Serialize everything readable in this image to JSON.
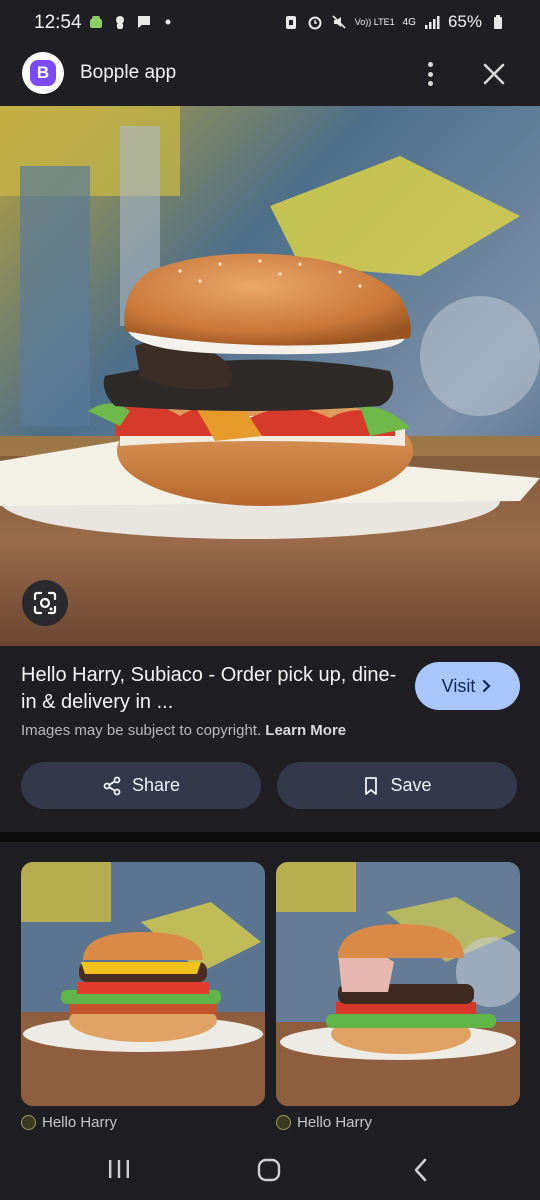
{
  "status": {
    "time": "12:54",
    "volte": "Vo)) LTE1",
    "network": "4G",
    "battery": "65%"
  },
  "app": {
    "title": "Bopple app",
    "icon_letter": "B"
  },
  "result": {
    "title": "Hello Harry, Subiaco - Order pick up, dine-in & delivery in ...",
    "copyright": "Images may be subject to copyright.",
    "learn_more": "Learn More",
    "visit_label": "Visit",
    "share_label": "Share",
    "save_label": "Save"
  },
  "related": [
    {
      "source": "Hello Harry"
    },
    {
      "source": "Hello Harry"
    }
  ],
  "colors": {
    "background": "#1f1f23",
    "visit_button": "#a9c6fb",
    "action_button": "#33394a"
  },
  "icons": [
    "google-lens-icon",
    "share-icon",
    "bookmark-icon",
    "chevron-right-icon",
    "more-vert-icon",
    "close-icon",
    "recent-apps-icon",
    "home-icon",
    "back-icon"
  ]
}
